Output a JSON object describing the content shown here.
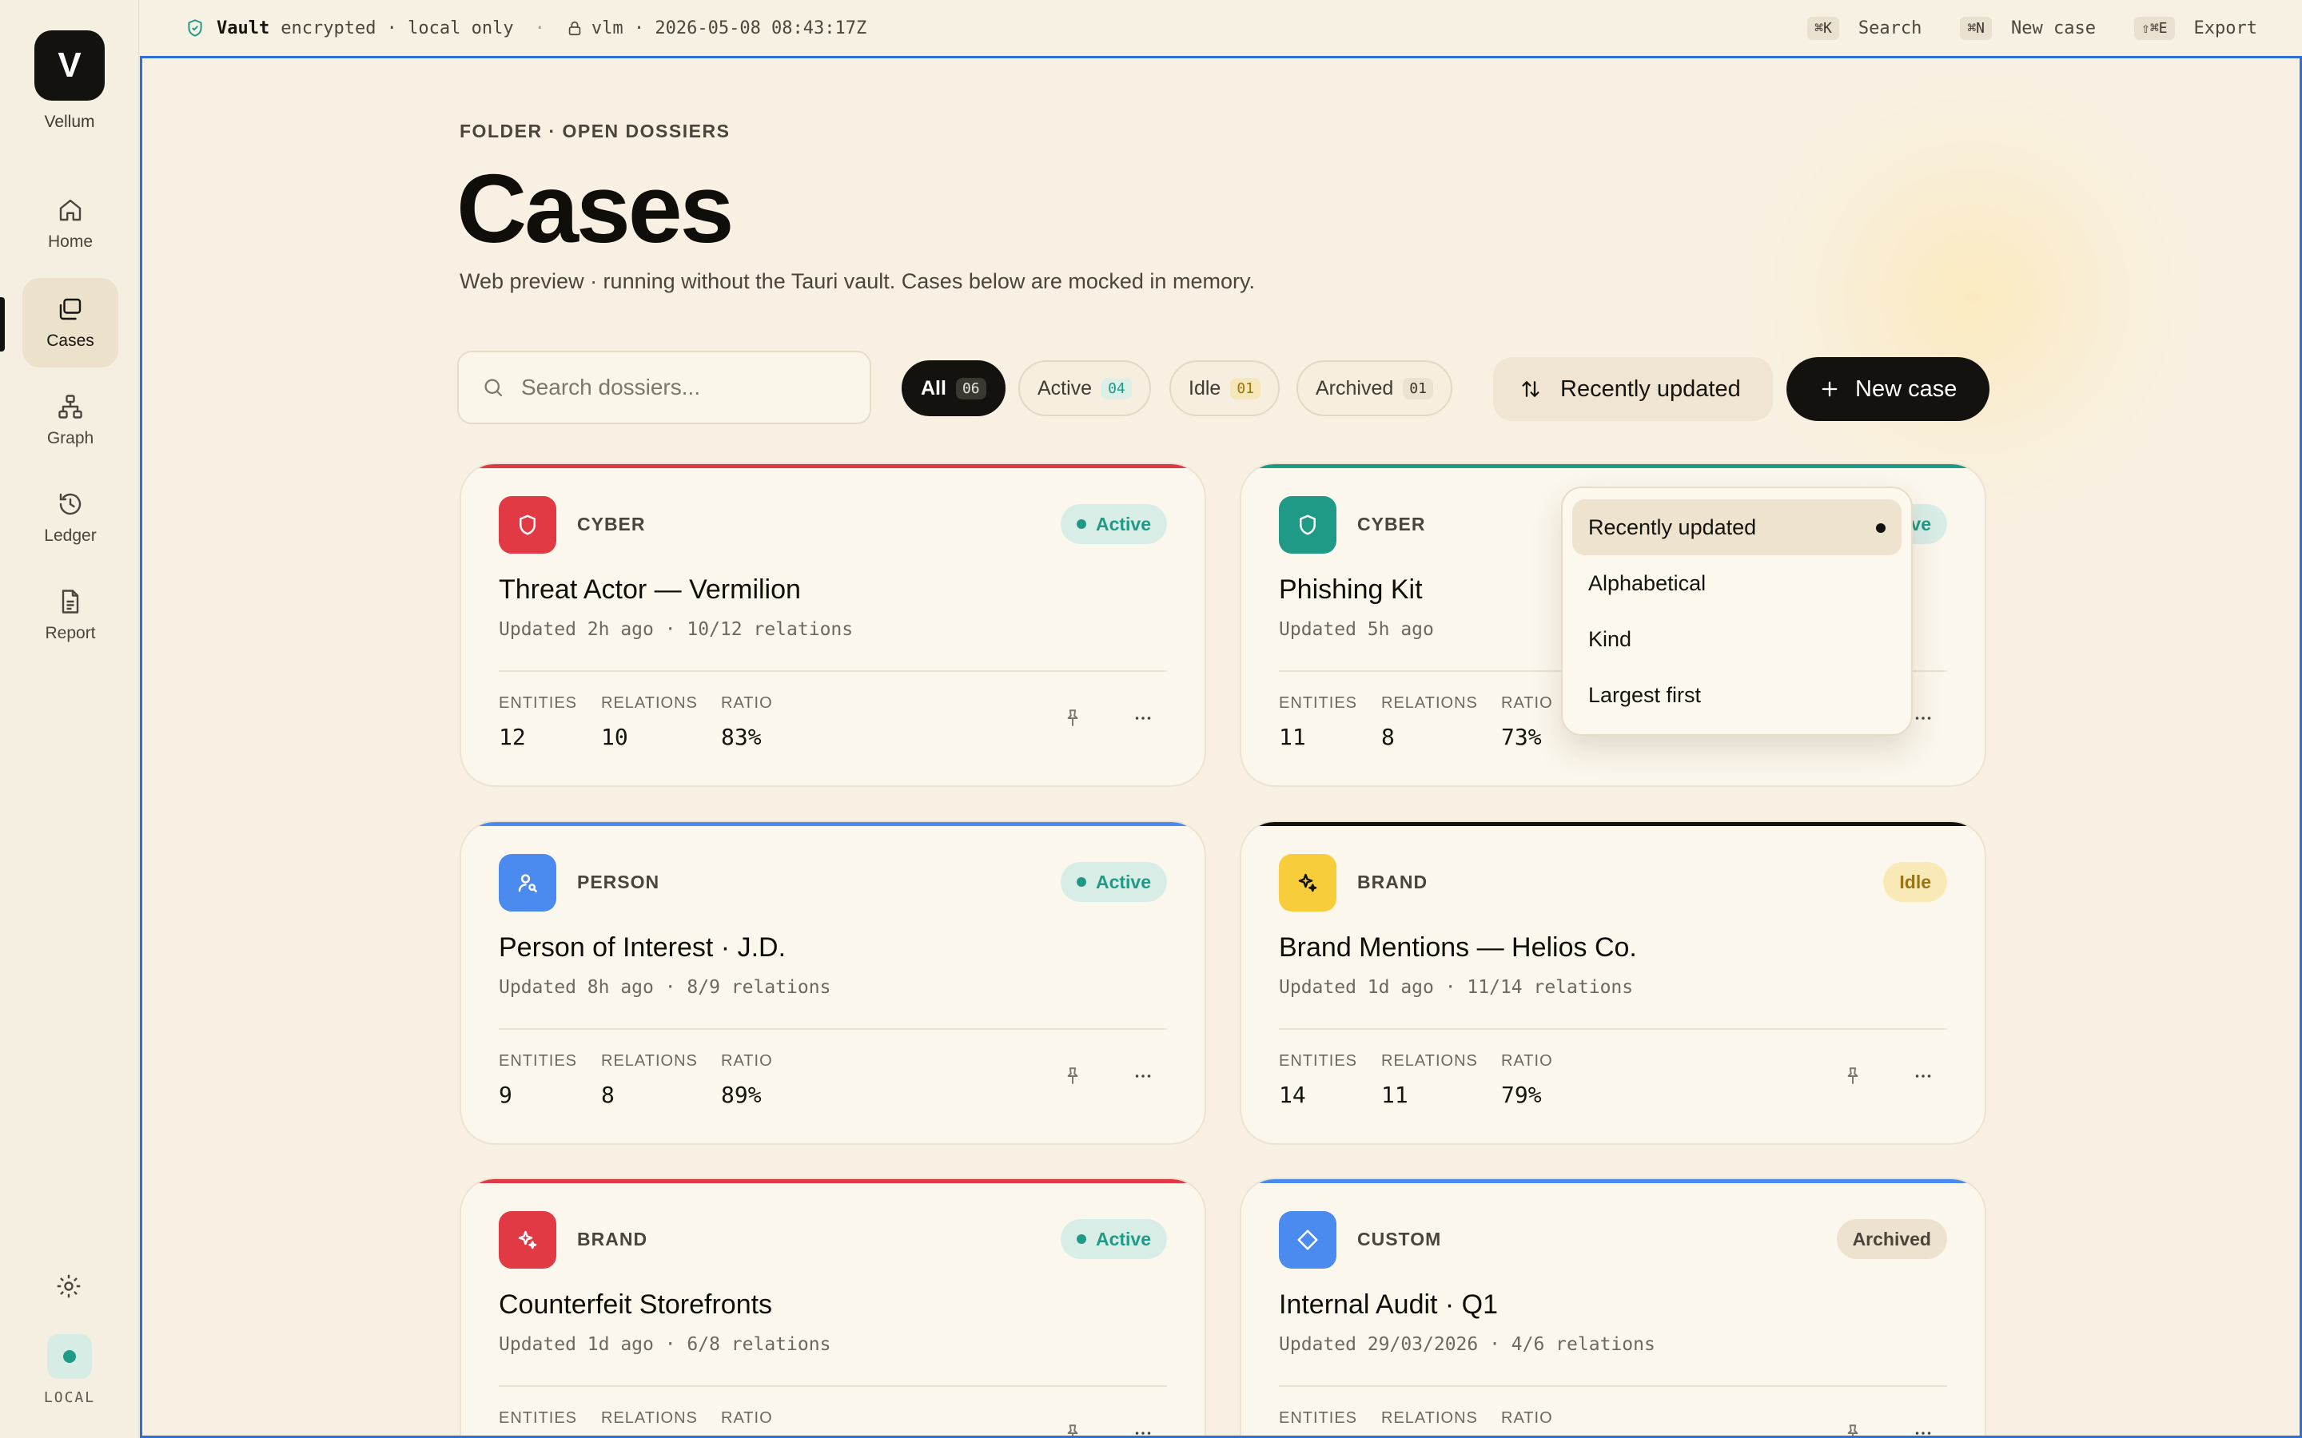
{
  "app": {
    "logo_letter": "V",
    "name": "Vellum"
  },
  "sidebar": {
    "items": [
      {
        "label": "Home",
        "icon": "home-icon"
      },
      {
        "label": "Cases",
        "icon": "folders-icon",
        "active": true
      },
      {
        "label": "Graph",
        "icon": "graph-icon"
      },
      {
        "label": "Ledger",
        "icon": "history-icon"
      },
      {
        "label": "Report",
        "icon": "report-icon"
      }
    ],
    "settings_icon": "gear-icon",
    "local_label": "LOCAL"
  },
  "topbar": {
    "vault_label": "Vault",
    "vault_status": "encrypted · local only",
    "separator": "·",
    "session": "vlm · 2026-05-08 08:43:17Z",
    "shortcuts": [
      {
        "keys": "⌘K",
        "label": "Search"
      },
      {
        "keys": "⌘N",
        "label": "New case"
      },
      {
        "keys": "⇧⌘E",
        "label": "Export"
      }
    ]
  },
  "page": {
    "eyebrow": "FOLDER · OPEN DOSSIERS",
    "title": "Cases",
    "subtitle": "Web preview · running without the Tauri vault. Cases below are mocked in memory."
  },
  "toolbar": {
    "search_placeholder": "Search dossiers...",
    "search_value": "",
    "filters": [
      {
        "label": "All",
        "count": "06",
        "selected": true
      },
      {
        "label": "Active",
        "count": "04"
      },
      {
        "label": "Idle",
        "count": "01"
      },
      {
        "label": "Archived",
        "count": "01"
      }
    ],
    "sort_label": "Recently updated",
    "new_case_label": "New case"
  },
  "sort_menu": {
    "options": [
      "Recently updated",
      "Alphabetical",
      "Kind",
      "Largest first"
    ],
    "selected": "Recently updated"
  },
  "stat_labels": {
    "entities": "ENTITIES",
    "relations": "RELATIONS",
    "ratio": "RATIO"
  },
  "cases": [
    {
      "kind": "CYBER",
      "status": "Active",
      "title": "Threat Actor — Vermilion",
      "meta": "Updated 2h ago · 10/12 relations",
      "entities": "12",
      "relations": "10",
      "ratio": "83%",
      "accent": "#e23a45",
      "icon": "shield-icon"
    },
    {
      "kind": "CYBER",
      "status": "Active",
      "title": "Phishing Kit",
      "meta": "Updated 5h ago",
      "entities": "11",
      "relations": "8",
      "ratio": "73%",
      "accent": "#1f9a86",
      "icon": "shield-icon"
    },
    {
      "kind": "PERSON",
      "status": "Active",
      "title": "Person of Interest · J.D.",
      "meta": "Updated 8h ago · 8/9 relations",
      "entities": "9",
      "relations": "8",
      "ratio": "89%",
      "accent": "#4b8bf0",
      "icon": "person-search-icon"
    },
    {
      "kind": "BRAND",
      "status": "Idle",
      "title": "Brand Mentions — Helios Co.",
      "meta": "Updated 1d ago · 11/14 relations",
      "entities": "14",
      "relations": "11",
      "ratio": "79%",
      "accent": "#f7cd3b",
      "icon": "sparkle-icon"
    },
    {
      "kind": "BRAND",
      "status": "Active",
      "title": "Counterfeit Storefronts",
      "meta": "Updated 1d ago · 6/8 relations",
      "entities": "",
      "relations": "",
      "ratio": "",
      "accent": "#e23a45",
      "icon": "sparkle-icon"
    },
    {
      "kind": "CUSTOM",
      "status": "Archived",
      "title": "Internal Audit · Q1",
      "meta": "Updated 29/03/2026 · 4/6 relations",
      "entities": "",
      "relations": "",
      "ratio": "",
      "accent": "#4b8bf0",
      "icon": "diamond-icon"
    }
  ],
  "colors": {
    "accent_teal": "#1f9a86",
    "ink": "#14120e",
    "selection_frame": "#2f6fd8"
  }
}
